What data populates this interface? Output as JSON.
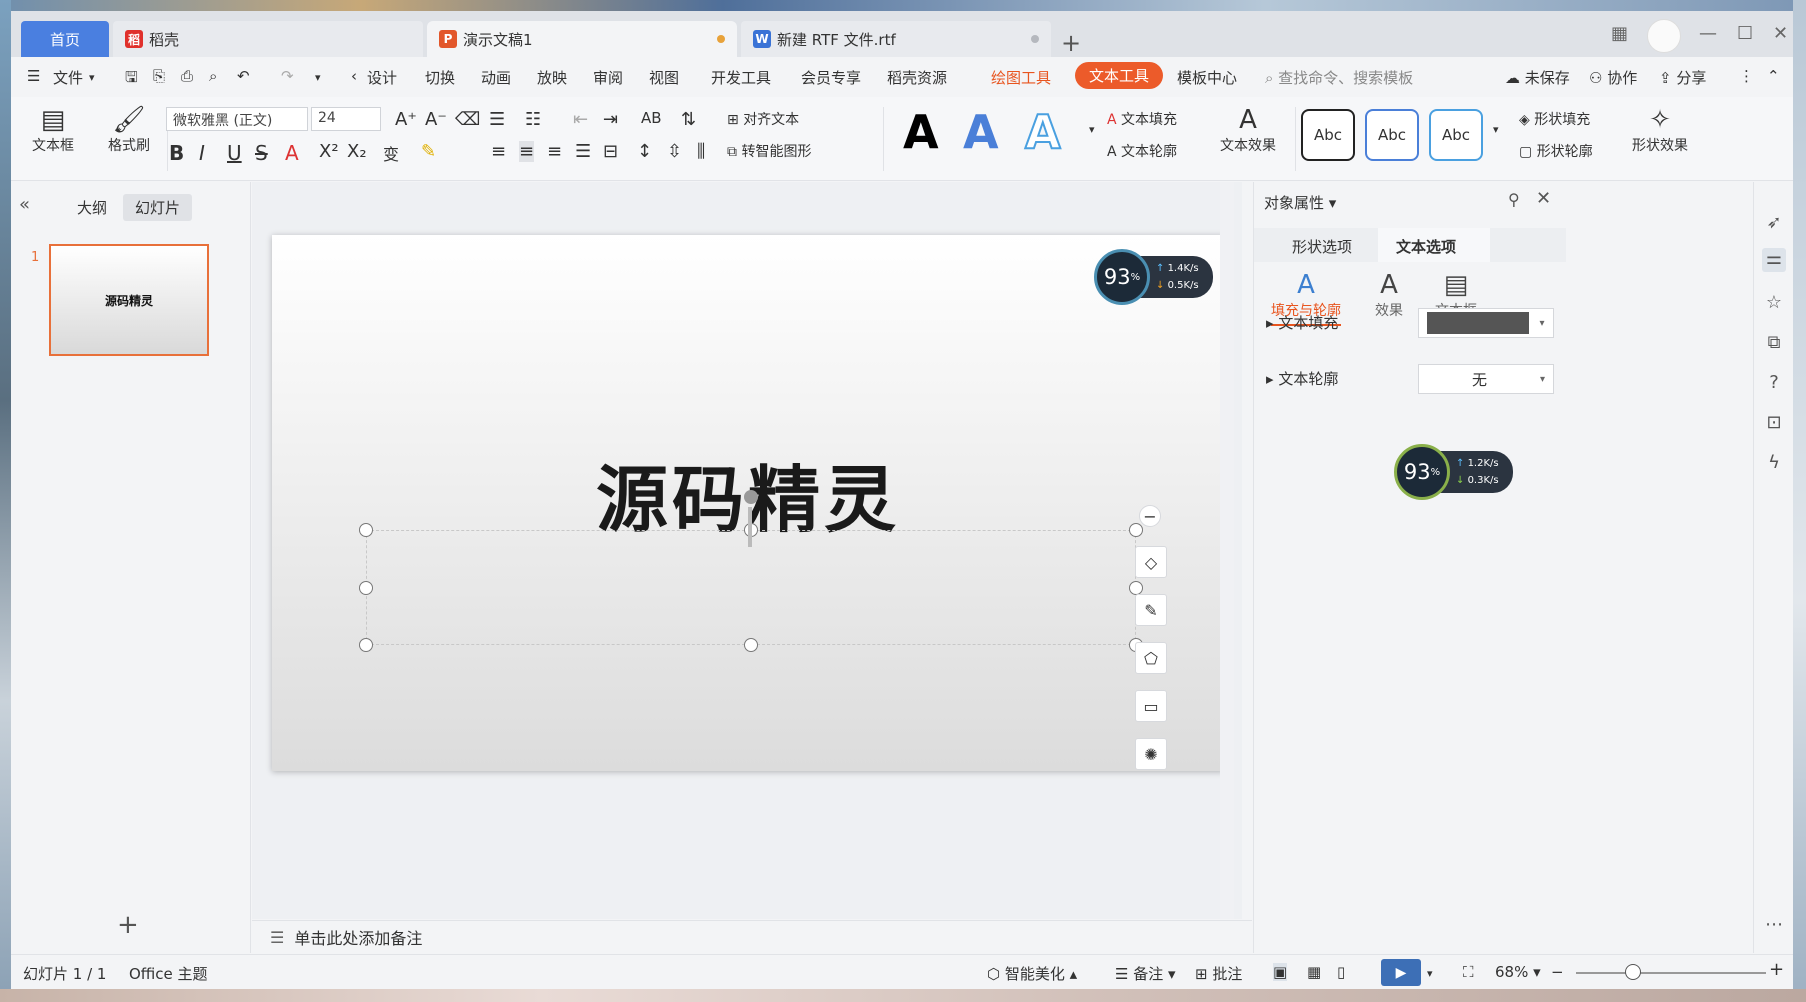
{
  "tabs": {
    "home": "首页",
    "daoke": "稻壳",
    "ppt": "演示文稿1",
    "rtf": "新建 RTF 文件.rtf"
  },
  "menu": {
    "file": "文件",
    "items": [
      "设计",
      "切换",
      "动画",
      "放映",
      "审阅",
      "视图",
      "开发工具",
      "会员专享",
      "稻壳资源"
    ],
    "draw_tool": "绘图工具",
    "text_tool": "文本工具",
    "template_center": "模板中心",
    "search_placeholder": "查找命令、搜索模板",
    "unsaved": "未保存",
    "collab": "协作",
    "share": "分享"
  },
  "ribbon": {
    "textbox": "文本框",
    "format_brush": "格式刷",
    "font_name": "微软雅黑 (正文)",
    "font_size": "24",
    "align_text": "对齐文本",
    "smart_shape": "转智能图形",
    "text_fill": "文本填充",
    "text_outline": "文本轮廓",
    "text_effect": "文本效果",
    "abc": "Abc",
    "shape_fill": "形状填充",
    "shape_outline": "形状轮廓",
    "shape_effect": "形状效果"
  },
  "left_panel": {
    "outline": "大纲",
    "slides": "幻灯片",
    "slide_number": "1",
    "thumb_title": "源码精灵"
  },
  "slide": {
    "title": "源码精灵"
  },
  "notes_placeholder": "单击此处添加备注",
  "speed_widget": {
    "percent": "93",
    "up": "1.4K/s",
    "down": "0.5K/s"
  },
  "speed_widget_2": {
    "percent": "93",
    "up": "1.2K/s",
    "down": "0.3K/s"
  },
  "right_panel": {
    "title": "对象属性",
    "tab_shape": "形状选项",
    "tab_text": "文本选项",
    "sub_fill": "填充与轮廓",
    "sub_effect": "效果",
    "sub_textbox": "文本框",
    "text_fill_label": "文本填充",
    "text_outline_label": "文本轮廓",
    "text_outline_value": "无",
    "fill_color": "#555555"
  },
  "status": {
    "slide_info": "幻灯片 1 / 1",
    "theme": "Office 主题",
    "smart_beautify": "智能美化",
    "notes": "备注",
    "comments": "批注",
    "zoom": "68%"
  },
  "colors": {
    "accent": "#ec5b2a",
    "home_tab": "#4a7fe0",
    "play": "#3d6fb6"
  }
}
